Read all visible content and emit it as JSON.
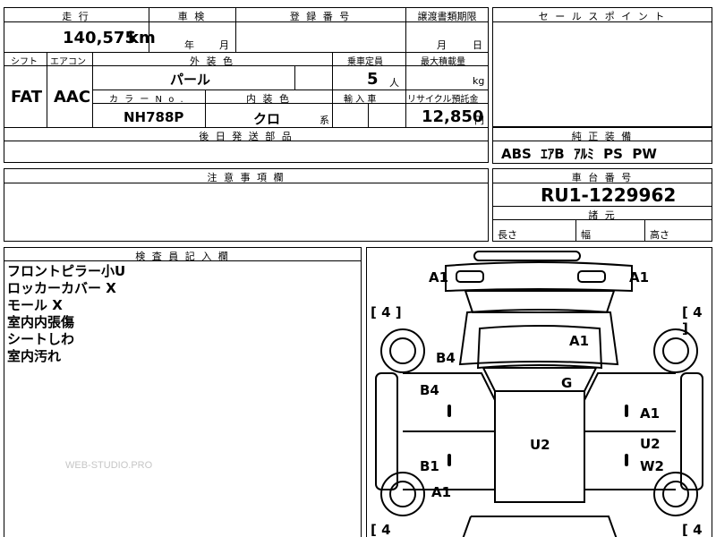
{
  "top_header": {
    "mileage_label": "走 行",
    "inspection_label": "車 検",
    "registration_label": "登 録 番 号",
    "transfer_deadline_label": "譲渡書類期限",
    "sales_point_label": "セ ー ル ス ポ イ ン ト"
  },
  "mileage": {
    "value": "140,575",
    "unit": "km"
  },
  "inspection": {
    "year_unit": "年",
    "month_unit": "月"
  },
  "transfer_deadline": {
    "month_unit": "月",
    "day_unit": "日"
  },
  "row2_header": {
    "shift": "シフト",
    "aircon": "エアコン",
    "exterior_color": "外 装 色",
    "capacity": "乗車定員",
    "max_load": "最大積載量"
  },
  "shift": "FAT",
  "aircon": "AAC",
  "exterior_color": "パール",
  "capacity": {
    "value": "5",
    "unit": "人"
  },
  "max_load": {
    "unit": "kg"
  },
  "row3_header": {
    "color_no": "カ ラ ー  N o .",
    "interior_color": "内 装 色",
    "import": "輸 入 車",
    "recycle": "リサイクル預託金"
  },
  "color_no": "NH788P",
  "interior_color": {
    "value": "クロ",
    "suffix": "系"
  },
  "recycle": {
    "value": "12,850",
    "unit": "円"
  },
  "later_parts_label": "後 日 発 送 部 品",
  "standard_equipment_label": "純 正 装 備",
  "standard_equipment": "ABS  ｴｱB  ｱﾙﾐ  PS  PW",
  "caution_label": "注 意 事 項 欄",
  "chassis_label": "車 台 番 号",
  "chassis_number": "RU1-1229962",
  "dimensions_label": "諸 元",
  "dimensions": {
    "length": "長さ",
    "width": "幅",
    "height": "高さ"
  },
  "inspector_label": "検 査 員 記 入 欄",
  "inspector_notes": [
    "フロントピラー小U",
    "ロッカーカバー X",
    "モール X",
    "室内内張傷",
    "シートしわ",
    "室内汚れ"
  ],
  "diagram": {
    "tire_front_left": "[ 4 ]",
    "tire_front_right": "[ 4 ]",
    "tire_rear_left": "[ 4",
    "tire_rear_right": "[ 4 ]",
    "marks": {
      "a1_front_left": "A1",
      "a1_front_right": "A1",
      "a1_windshield": "A1",
      "b4_upper": "B4",
      "b4_lower": "B4",
      "g_glass": "G",
      "a1_right_door": "A1",
      "u2_roof": "U2",
      "u2_right": "U2",
      "b1_left": "B1",
      "w2_right": "W2",
      "a1_rear_left": "A1"
    }
  },
  "watermark": "WEB-STUDIO.PRO"
}
